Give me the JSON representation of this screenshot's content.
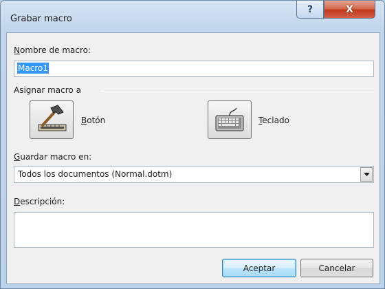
{
  "window": {
    "title": "Grabar macro",
    "help_glyph": "?",
    "close_glyph": "X"
  },
  "macro_name": {
    "label_mnemonic": "N",
    "label_rest": "ombre de macro:",
    "value": "Macro1"
  },
  "assign": {
    "label": "Asignar macro a",
    "button": {
      "mnemonic": "B",
      "rest": "otón",
      "icon": "hammer-icon"
    },
    "keyboard": {
      "mnemonic": "T",
      "rest": "eclado",
      "icon": "keyboard-icon"
    }
  },
  "store_in": {
    "label_mnemonic": "G",
    "label_rest": "uardar macro en:",
    "selected": "Todos los documentos (Normal.dotm)"
  },
  "description": {
    "label_mnemonic": "D",
    "label_rest": "escripción:",
    "value": ""
  },
  "buttons": {
    "ok": "Aceptar",
    "cancel": "Cancelar"
  },
  "colors": {
    "selection": "#3399ff",
    "close_button": "#c2381d",
    "default_button_border": "#3c7fb1"
  }
}
